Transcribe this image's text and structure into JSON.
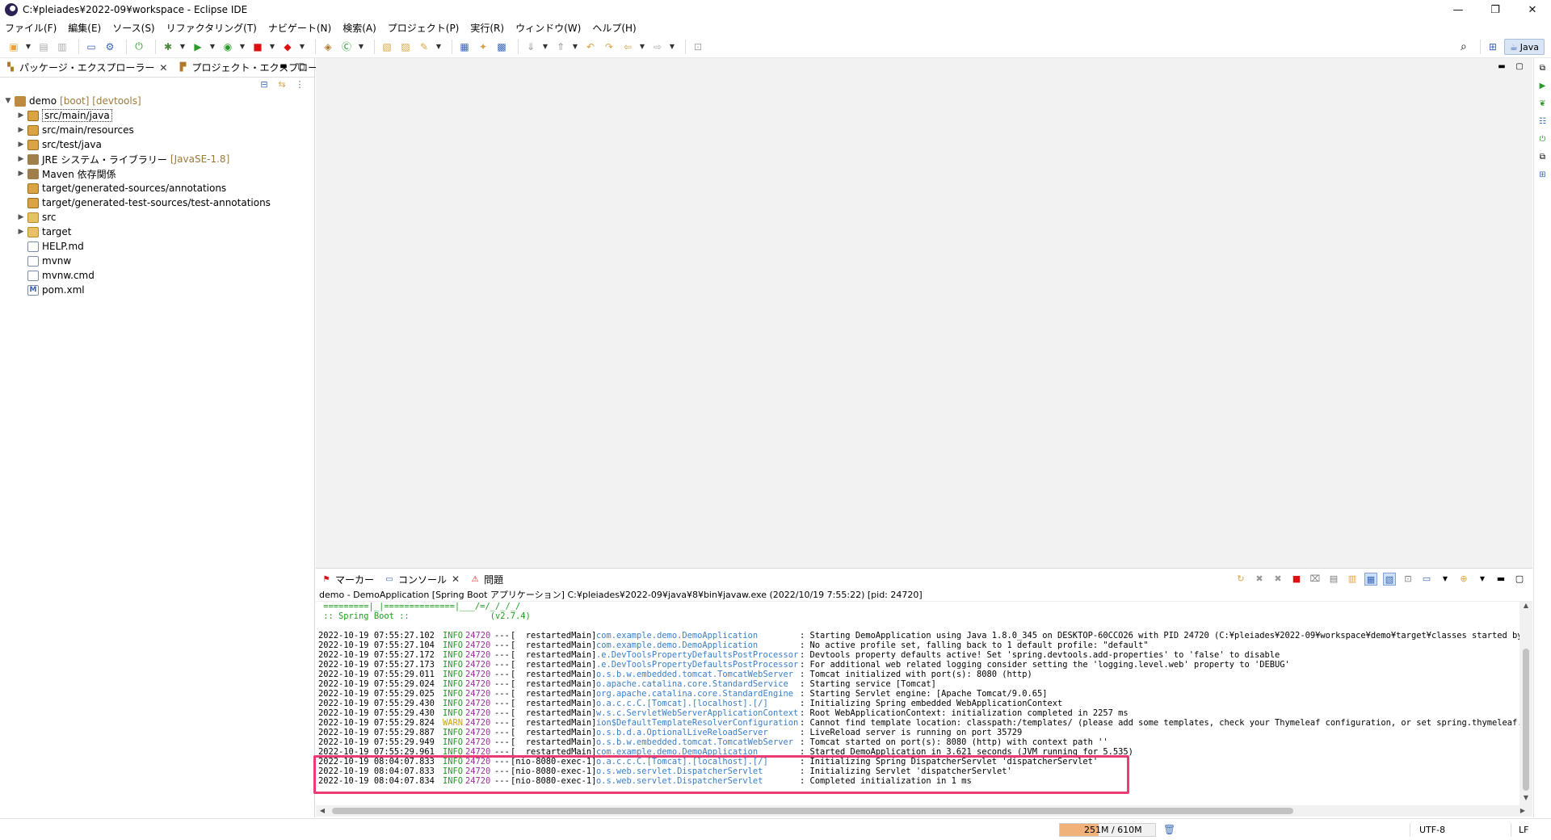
{
  "window": {
    "title": "C:¥pleiades¥2022-09¥workspace - Eclipse IDE",
    "minimize_glyph": "—",
    "restore_glyph": "❐",
    "close_glyph": "✕"
  },
  "menu": [
    "ファイル(F)",
    "編集(E)",
    "ソース(S)",
    "リファクタリング(T)",
    "ナビゲート(N)",
    "検索(A)",
    "プロジェクト(P)",
    "実行(R)",
    "ウィンドウ(W)",
    "ヘルプ(H)"
  ],
  "toolbar": {
    "perspective_label": "Java"
  },
  "explorer": {
    "tabs": [
      "パッケージ・エクスプローラー",
      "プロジェクト・エクスプローラー"
    ],
    "project": {
      "name": "demo",
      "decorations": "[boot] [devtools]"
    },
    "items": [
      {
        "label": "src/main/java",
        "decor": ""
      },
      {
        "label": "src/main/resources",
        "decor": ""
      },
      {
        "label": "src/test/java",
        "decor": ""
      },
      {
        "label": "JRE システム・ライブラリー",
        "decor": "[JavaSE-1.8]"
      },
      {
        "label": "Maven 依存関係",
        "decor": ""
      },
      {
        "label": "target/generated-sources/annotations",
        "decor": ""
      },
      {
        "label": "target/generated-test-sources/test-annotations",
        "decor": ""
      },
      {
        "label": "src",
        "decor": ""
      },
      {
        "label": "target",
        "decor": ""
      },
      {
        "label": "HELP.md",
        "decor": ""
      },
      {
        "label": "mvnw",
        "decor": ""
      },
      {
        "label": "mvnw.cmd",
        "decor": ""
      },
      {
        "label": "pom.xml",
        "decor": ""
      }
    ]
  },
  "console": {
    "tabs": [
      "マーカー",
      "コンソール",
      "問題"
    ],
    "description": "demo - DemoApplication [Spring Boot アプリケーション] C:¥pleiades¥2022-09¥java¥8¥bin¥javaw.exe (2022/10/19 7:55:22) [pid: 24720]",
    "banner": [
      " =========|_|==============|___/=/_/_/_/",
      " :: Spring Boot ::                (v2.7.4)"
    ],
    "lines": [
      {
        "ts": "2022-10-19 07:55:27.102",
        "level": "INFO",
        "pid": "24720",
        "dash": "---",
        "thread": "[  restartedMain]",
        "logger": "com.example.demo.DemoApplication",
        "msg": ": Starting DemoApplication using Java 1.8.0_345 on DESKTOP-60CCO26 with PID 24720 (C:¥pleiades¥2022-09¥workspace¥demo¥target¥classes started by kiyo"
      },
      {
        "ts": "2022-10-19 07:55:27.104",
        "level": "INFO",
        "pid": "24720",
        "dash": "---",
        "thread": "[  restartedMain]",
        "logger": "com.example.demo.DemoApplication",
        "msg": ": No active profile set, falling back to 1 default profile: \"default\""
      },
      {
        "ts": "2022-10-19 07:55:27.172",
        "level": "INFO",
        "pid": "24720",
        "dash": "---",
        "thread": "[  restartedMain]",
        "logger": ".e.DevToolsPropertyDefaultsPostProcessor",
        "msg": ": Devtools property defaults active! Set 'spring.devtools.add-properties' to 'false' to disable"
      },
      {
        "ts": "2022-10-19 07:55:27.173",
        "level": "INFO",
        "pid": "24720",
        "dash": "---",
        "thread": "[  restartedMain]",
        "logger": ".e.DevToolsPropertyDefaultsPostProcessor",
        "msg": ": For additional web related logging consider setting the 'logging.level.web' property to 'DEBUG'"
      },
      {
        "ts": "2022-10-19 07:55:29.011",
        "level": "INFO",
        "pid": "24720",
        "dash": "---",
        "thread": "[  restartedMain]",
        "logger": "o.s.b.w.embedded.tomcat.TomcatWebServer",
        "msg": ": Tomcat initialized with port(s): 8080 (http)"
      },
      {
        "ts": "2022-10-19 07:55:29.024",
        "level": "INFO",
        "pid": "24720",
        "dash": "---",
        "thread": "[  restartedMain]",
        "logger": "o.apache.catalina.core.StandardService",
        "msg": ": Starting service [Tomcat]"
      },
      {
        "ts": "2022-10-19 07:55:29.025",
        "level": "INFO",
        "pid": "24720",
        "dash": "---",
        "thread": "[  restartedMain]",
        "logger": "org.apache.catalina.core.StandardEngine",
        "msg": ": Starting Servlet engine: [Apache Tomcat/9.0.65]"
      },
      {
        "ts": "2022-10-19 07:55:29.430",
        "level": "INFO",
        "pid": "24720",
        "dash": "---",
        "thread": "[  restartedMain]",
        "logger": "o.a.c.c.C.[Tomcat].[localhost].[/]",
        "msg": ": Initializing Spring embedded WebApplicationContext"
      },
      {
        "ts": "2022-10-19 07:55:29.430",
        "level": "INFO",
        "pid": "24720",
        "dash": "---",
        "thread": "[  restartedMain]",
        "logger": "w.s.c.ServletWebServerApplicationContext",
        "msg": ": Root WebApplicationContext: initialization completed in 2257 ms"
      },
      {
        "ts": "2022-10-19 07:55:29.824",
        "level": "WARN",
        "pid": "24720",
        "dash": "---",
        "thread": "[  restartedMain]",
        "logger": "ion$DefaultTemplateResolverConfiguration",
        "msg": ": Cannot find template location: classpath:/templates/ (please add some templates, check your Thymeleaf configuration, or set spring.thymeleaf.check-"
      },
      {
        "ts": "2022-10-19 07:55:29.887",
        "level": "INFO",
        "pid": "24720",
        "dash": "---",
        "thread": "[  restartedMain]",
        "logger": "o.s.b.d.a.OptionalLiveReloadServer",
        "msg": ": LiveReload server is running on port 35729"
      },
      {
        "ts": "2022-10-19 07:55:29.949",
        "level": "INFO",
        "pid": "24720",
        "dash": "---",
        "thread": "[  restartedMain]",
        "logger": "o.s.b.w.embedded.tomcat.TomcatWebServer",
        "msg": ": Tomcat started on port(s): 8080 (http) with context path ''"
      },
      {
        "ts": "2022-10-19 07:55:29.961",
        "level": "INFO",
        "pid": "24720",
        "dash": "---",
        "thread": "[  restartedMain]",
        "logger": "com.example.demo.DemoApplication",
        "msg": ": Started DemoApplication in 3.621 seconds (JVM running for 5.535)"
      },
      {
        "ts": "2022-10-19 08:04:07.833",
        "level": "INFO",
        "pid": "24720",
        "dash": "---",
        "thread": "[nio-8080-exec-1]",
        "logger": "o.a.c.c.C.[Tomcat].[localhost].[/]",
        "msg": ": Initializing Spring DispatcherServlet 'dispatcherServlet'"
      },
      {
        "ts": "2022-10-19 08:04:07.833",
        "level": "INFO",
        "pid": "24720",
        "dash": "---",
        "thread": "[nio-8080-exec-1]",
        "logger": "o.s.web.servlet.DispatcherServlet",
        "msg": ": Initializing Servlet 'dispatcherServlet'"
      },
      {
        "ts": "2022-10-19 08:04:07.834",
        "level": "INFO",
        "pid": "24720",
        "dash": "---",
        "thread": "[nio-8080-exec-1]",
        "logger": "o.s.web.servlet.DispatcherServlet",
        "msg": ": Completed initialization in 1 ms"
      }
    ]
  },
  "status": {
    "heap": "251M / 610M",
    "heap_fraction": 0.41,
    "encoding": "UTF-8",
    "line_delimiter": "LF"
  },
  "colors": {
    "highlight": "#ea3b73",
    "info": "#1f9d1f",
    "warn": "#c8a200",
    "logger": "#3a7ec8"
  }
}
